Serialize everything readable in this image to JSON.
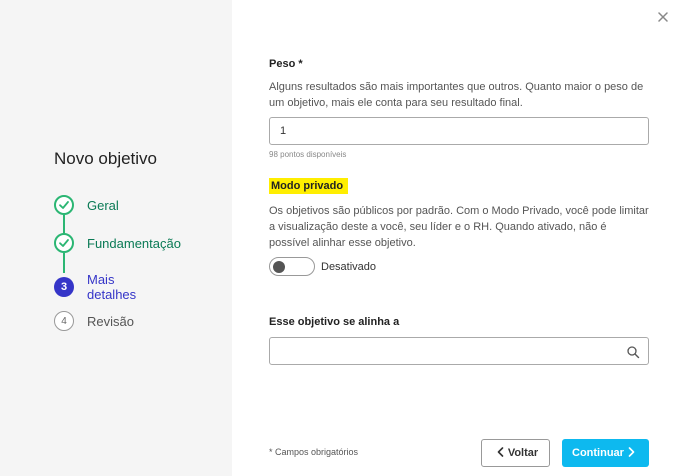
{
  "sidebar": {
    "title": "Novo objetivo",
    "steps": [
      {
        "number": "1",
        "label": "Geral",
        "state": "done"
      },
      {
        "number": "2",
        "label": "Fundamentação",
        "state": "done"
      },
      {
        "number": "3",
        "label": "Mais detalhes",
        "state": "active"
      },
      {
        "number": "4",
        "label": "Revisão",
        "state": "todo"
      }
    ]
  },
  "close_icon": "close-icon",
  "form": {
    "weight": {
      "label": "Peso *",
      "description": "Alguns resultados são mais importantes que outros. Quanto maior o peso de um objetivo, mais ele conta para seu resultado final.",
      "value": "1",
      "hint": "98 pontos disponíveis"
    },
    "private_mode": {
      "label": "Modo privado",
      "description": "Os objetivos são públicos por padrão. Com o Modo Privado, você pode limitar a visualização deste a você, seu líder e o RH. Quando ativado, não é possível alinhar esse objetivo.",
      "toggle_text": "Desativado",
      "enabled": false
    },
    "alignment": {
      "label": "Esse objetivo se alinha a",
      "value": "",
      "placeholder": ""
    }
  },
  "footer": {
    "required_note": "* Campos obrigatórios",
    "back_label": "Voltar",
    "next_label": "Continuar"
  },
  "colors": {
    "done": "#2bb673",
    "active": "#3535c8",
    "primary_button": "#0db9ef",
    "highlight": "#ffee00"
  }
}
